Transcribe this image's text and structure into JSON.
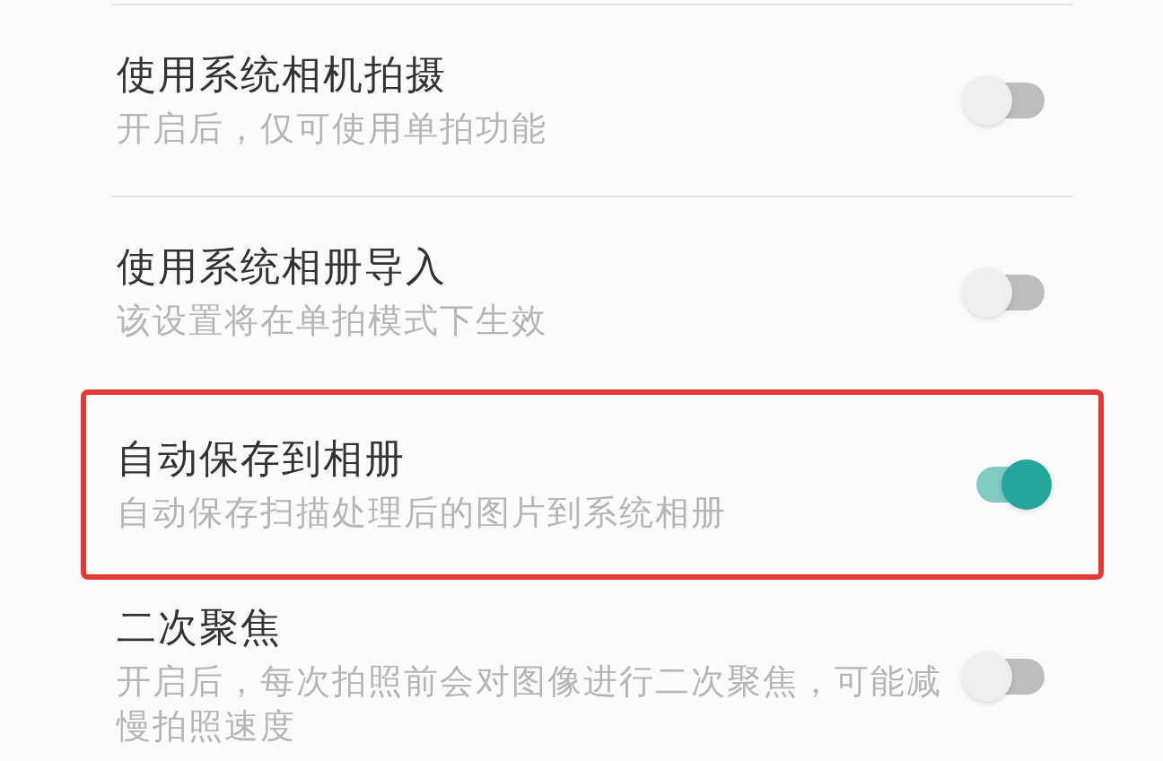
{
  "settings": [
    {
      "title": "使用系统相机拍摄",
      "subtitle": "开启后，仅可使用单拍功能",
      "on": false,
      "highlighted": false
    },
    {
      "title": "使用系统相册导入",
      "subtitle": "该设置将在单拍模式下生效",
      "on": false,
      "highlighted": false
    },
    {
      "title": "自动保存到相册",
      "subtitle": "自动保存扫描处理后的图片到系统相册",
      "on": true,
      "highlighted": true
    },
    {
      "title": "二次聚焦",
      "subtitle": "开启后，每次拍照前会对图像进行二次聚焦，可能减慢拍照速度",
      "on": false,
      "highlighted": false
    }
  ]
}
